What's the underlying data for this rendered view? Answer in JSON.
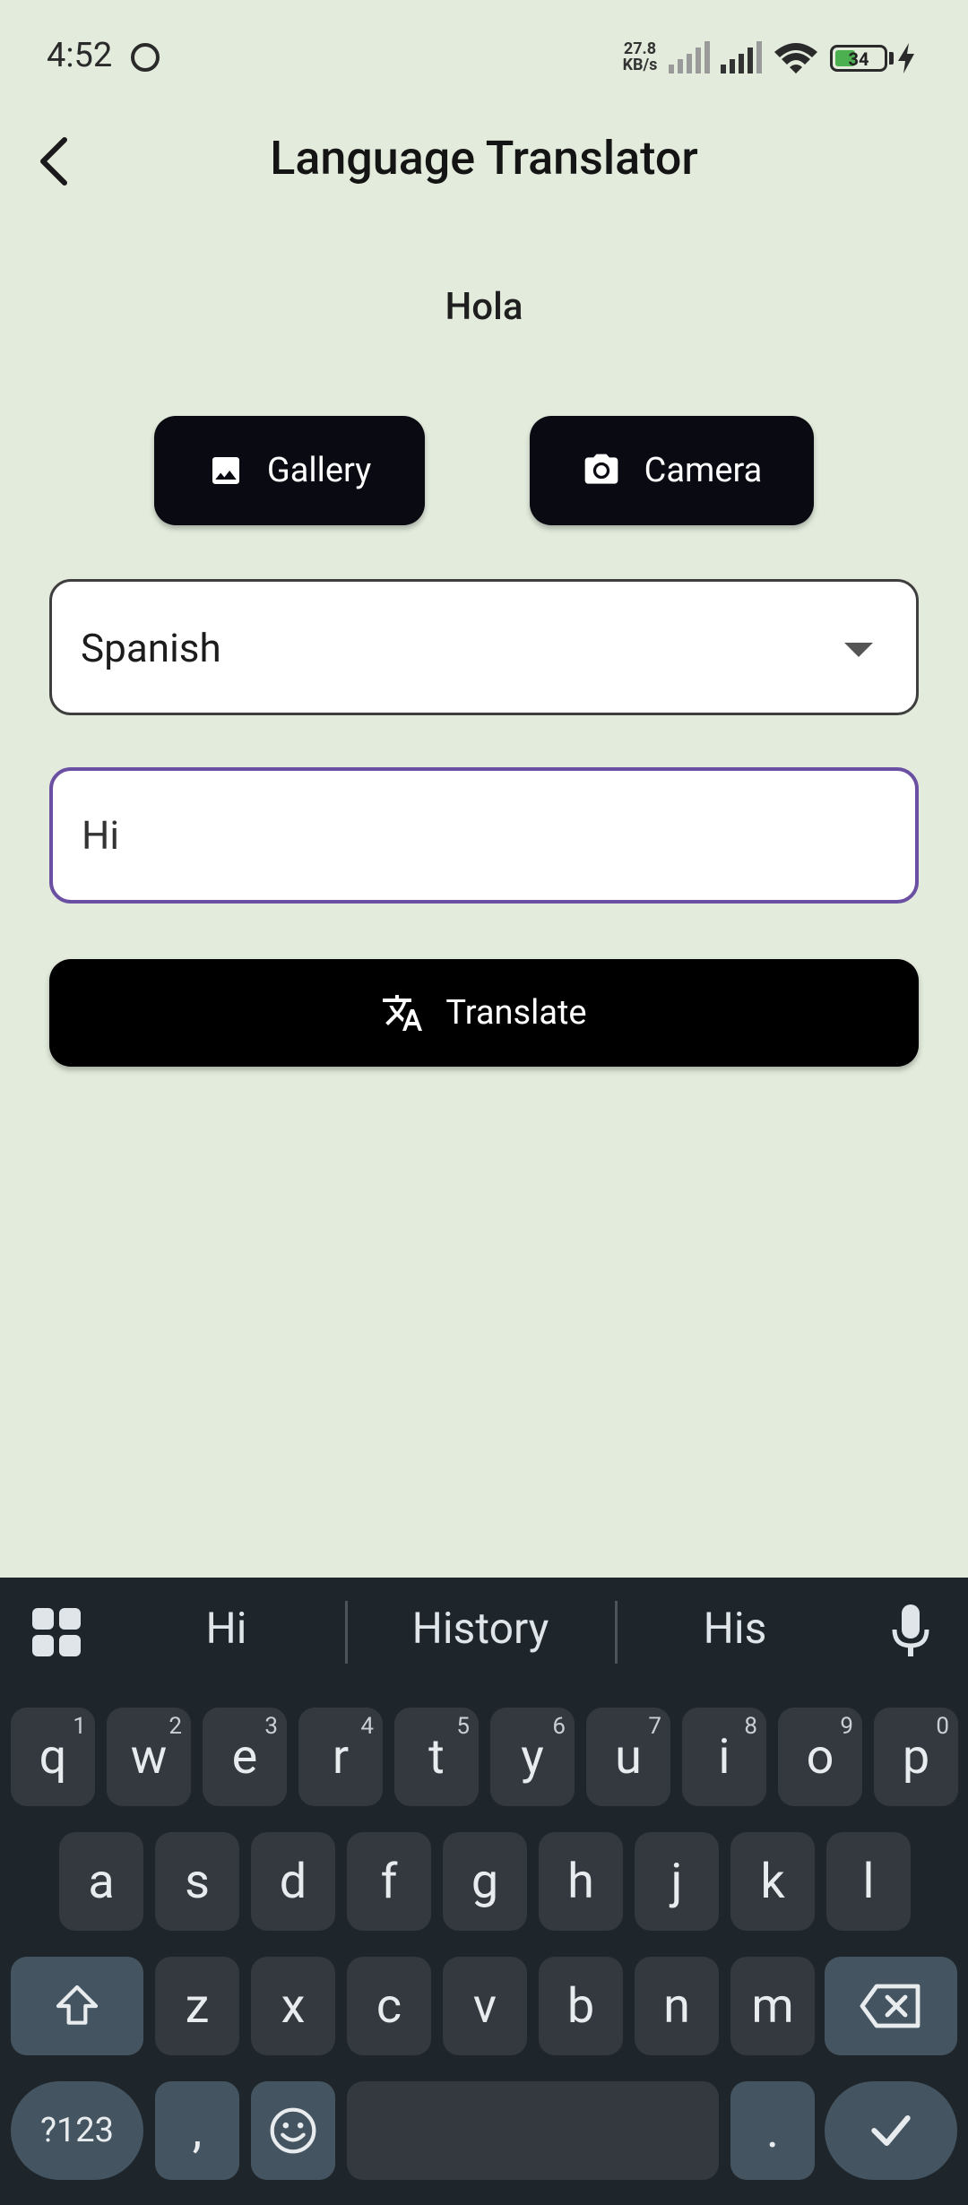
{
  "status_bar": {
    "time": "4:52",
    "net_speed_value": "27.8",
    "net_speed_unit": "KB/s",
    "battery": "34"
  },
  "app_bar": {
    "title": "Language Translator"
  },
  "result": {
    "text": "Hola"
  },
  "buttons": {
    "gallery": "Gallery",
    "camera": "Camera",
    "translate": "Translate"
  },
  "language_select": {
    "selected": "Spanish"
  },
  "input": {
    "value": "Hi"
  },
  "keyboard": {
    "suggestions": [
      "Hi",
      "History",
      "His"
    ],
    "row1": [
      {
        "key": "q",
        "hint": "1"
      },
      {
        "key": "w",
        "hint": "2"
      },
      {
        "key": "e",
        "hint": "3"
      },
      {
        "key": "r",
        "hint": "4"
      },
      {
        "key": "t",
        "hint": "5"
      },
      {
        "key": "y",
        "hint": "6"
      },
      {
        "key": "u",
        "hint": "7"
      },
      {
        "key": "i",
        "hint": "8"
      },
      {
        "key": "o",
        "hint": "9"
      },
      {
        "key": "p",
        "hint": "0"
      }
    ],
    "row2": [
      "a",
      "s",
      "d",
      "f",
      "g",
      "h",
      "j",
      "k",
      "l"
    ],
    "row3": [
      "z",
      "x",
      "c",
      "v",
      "b",
      "n",
      "m"
    ],
    "symbols_key": "?123",
    "comma_key": ",",
    "period_key": "."
  },
  "colors": {
    "background": "#e2ebdc",
    "button": "#0a0a12",
    "input_focus_border": "#6a4fa3",
    "keyboard_bg": "#1f262b",
    "key_bg": "#33393e",
    "special_key_bg": "#445561"
  }
}
